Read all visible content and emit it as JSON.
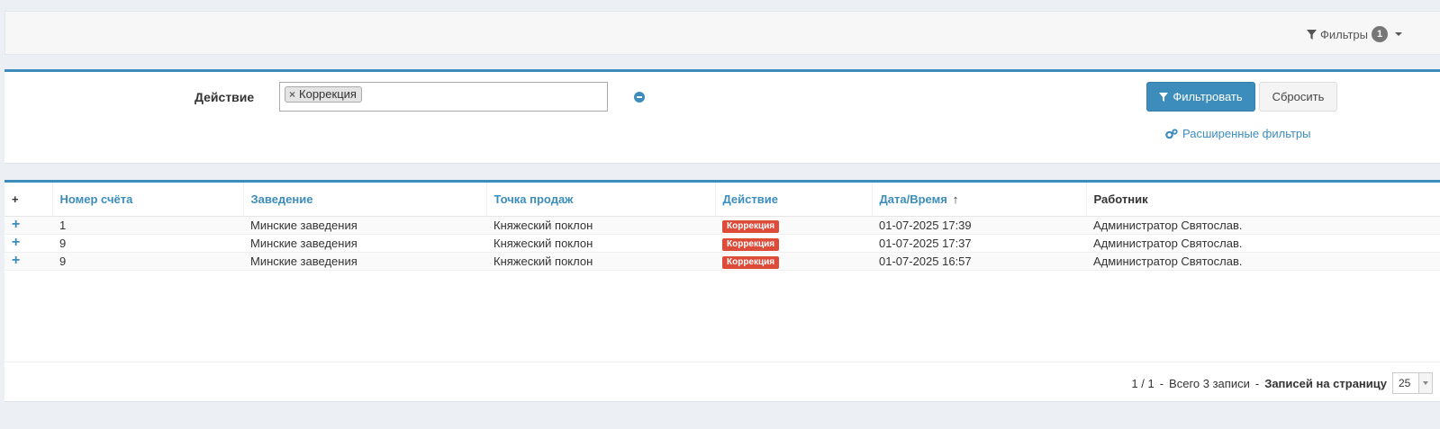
{
  "topbar": {
    "filters_label": "Фильтры",
    "filters_count": "1"
  },
  "filter": {
    "label": "Действие",
    "selected_chip": "Коррекция",
    "chip_remove": "×",
    "apply_label": "Фильтровать",
    "reset_label": "Сбросить",
    "advanced_label": "Расширенные фильтры"
  },
  "table": {
    "headers": {
      "expand": "+",
      "invoice": "Номер счёта",
      "venue": "Заведение",
      "point": "Точка продаж",
      "action": "Действие",
      "datetime": "Дата/Время",
      "sort_arrow": "↑",
      "worker": "Работник"
    },
    "rows": [
      {
        "expand": "+",
        "invoice": "1",
        "venue": "Минские заведения",
        "point": "Княжеский поклон",
        "action": "Коррекция",
        "datetime": "01-07-2025 17:39",
        "worker": "Администратор Святослав."
      },
      {
        "expand": "+",
        "invoice": "9",
        "venue": "Минские заведения",
        "point": "Княжеский поклон",
        "action": "Коррекция",
        "datetime": "01-07-2025 17:37",
        "worker": "Администратор Святослав."
      },
      {
        "expand": "+",
        "invoice": "9",
        "venue": "Минские заведения",
        "point": "Княжеский поклон",
        "action": "Коррекция",
        "datetime": "01-07-2025 16:57",
        "worker": "Администратор Святослав."
      }
    ]
  },
  "pager": {
    "page_info": "1 / 1",
    "sep1": "-",
    "total": "Всего 3 записи",
    "sep2": "-",
    "per_page_label": "Записей на страницу",
    "per_page_value": "25"
  },
  "colors": {
    "accent": "#3c8dbc",
    "danger": "#dd4b39"
  }
}
